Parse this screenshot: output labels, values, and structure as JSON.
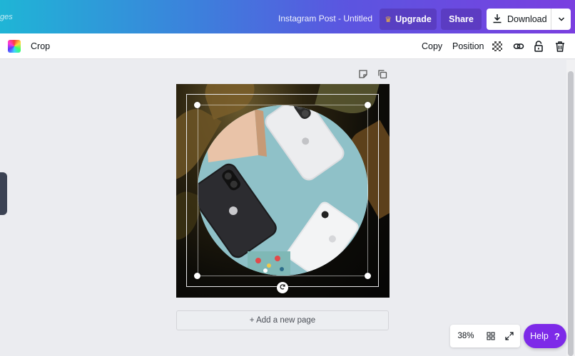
{
  "header": {
    "left_text": "ges",
    "doc_title": "Instagram Post - Untitled",
    "upgrade_label": "Upgrade",
    "share_label": "Share",
    "download_label": "Download",
    "gradient_colors": [
      "#1fb5d6",
      "#3d7fdc",
      "#5b55e0",
      "#7a3fe0"
    ]
  },
  "toolbar": {
    "crop_label": "Crop",
    "copy_label": "Copy",
    "position_label": "Position",
    "icons": [
      "color-palette-icon",
      "transparency-icon",
      "link-icon",
      "lock-icon",
      "trash-icon"
    ]
  },
  "canvas": {
    "page_tool_icons": [
      "note-icon",
      "duplicate-page-icon"
    ],
    "add_page_label": "+ Add a new page",
    "photo_subject": "phones on teal background in circle frame"
  },
  "footer": {
    "zoom": "38%",
    "help_label": "Help",
    "help_symbol": "?",
    "help_color": "#7d2ae8"
  }
}
